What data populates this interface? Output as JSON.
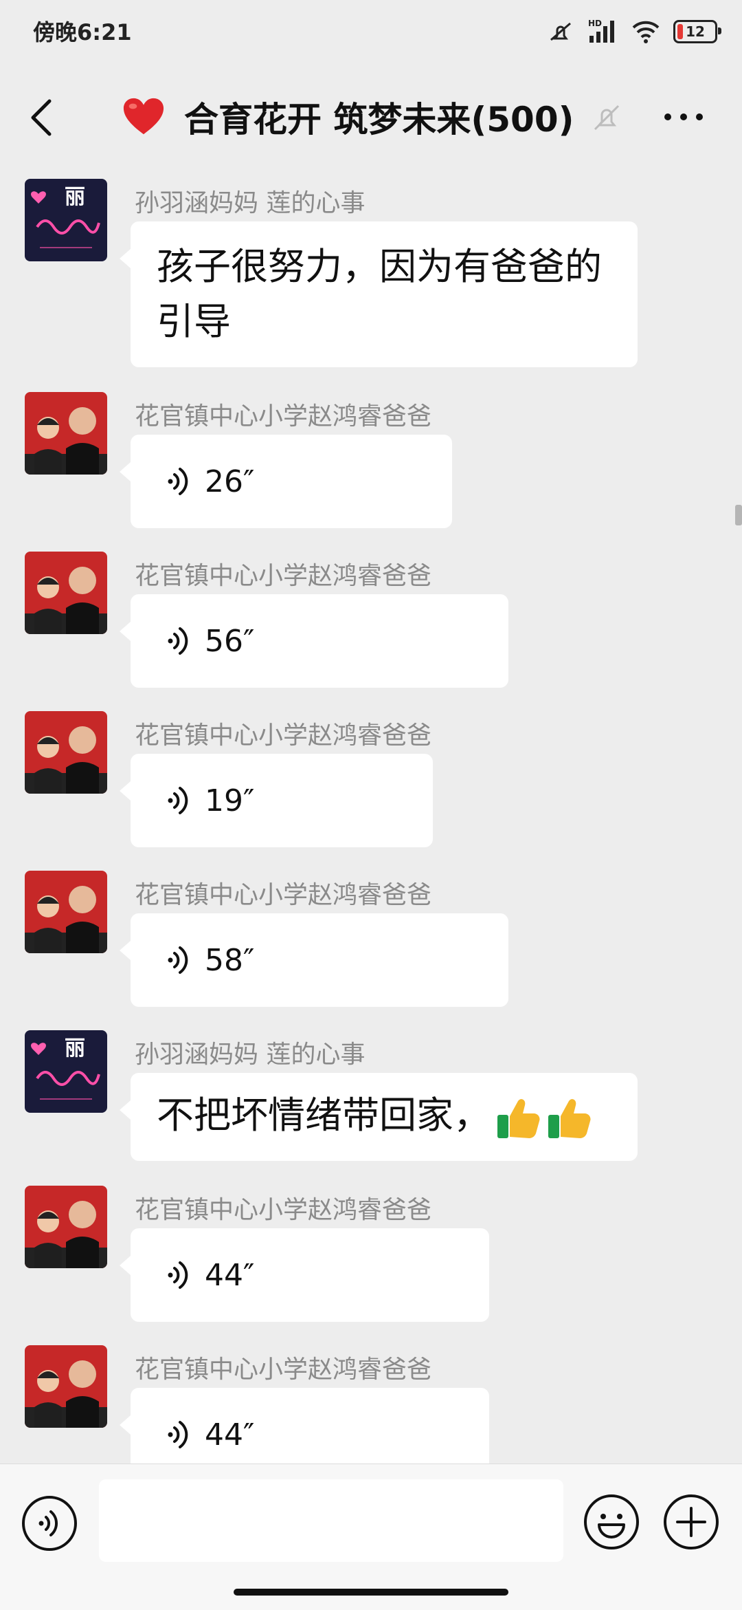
{
  "status_bar": {
    "time": "傍晚6:21",
    "battery": "12",
    "network": "HD"
  },
  "header": {
    "title": "合育花开 筑梦未来(500)"
  },
  "messages": [
    {
      "sender": "孙羽涵妈妈  莲的心事",
      "type": "text",
      "text_lines": [
        "孩子很努力，因为有爸爸的",
        "引导"
      ],
      "avatar": "mom"
    },
    {
      "sender": "花官镇中心小学赵鸿睿爸爸",
      "type": "voice",
      "duration": "26″",
      "avatar": "dad"
    },
    {
      "sender": "花官镇中心小学赵鸿睿爸爸",
      "type": "voice",
      "duration": "56″",
      "avatar": "dad"
    },
    {
      "sender": "花官镇中心小学赵鸿睿爸爸",
      "type": "voice",
      "duration": "19″",
      "avatar": "dad"
    },
    {
      "sender": "花官镇中心小学赵鸿睿爸爸",
      "type": "voice",
      "duration": "58″",
      "avatar": "dad"
    },
    {
      "sender": "孙羽涵妈妈  莲的心事",
      "type": "text",
      "text_lines": [
        "不把坏情绪带回家，"
      ],
      "emoji": "thumbs-up x2",
      "avatar": "mom"
    },
    {
      "sender": "花官镇中心小学赵鸿睿爸爸",
      "type": "voice",
      "duration": "44″",
      "avatar": "dad"
    },
    {
      "sender": "花官镇中心小学赵鸿睿爸爸",
      "type": "voice",
      "duration": "44″",
      "avatar": "dad"
    }
  ],
  "avatars": {
    "mom_text": "丽"
  },
  "colors": {
    "background": "#ededed",
    "bubble": "#ffffff",
    "sender": "#8a8a8a",
    "heart": "#e0262b",
    "dad_avatar_bg": "#c62828"
  }
}
